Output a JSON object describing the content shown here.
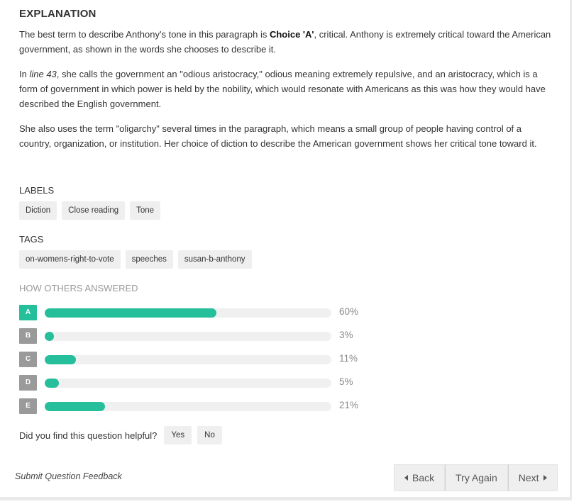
{
  "explanation": {
    "heading": "EXPLANATION",
    "p1_before": "The best term to describe Anthony's tone in this paragraph is ",
    "p1_bold": "Choice 'A'",
    "p1_after": ", critical. Anthony is extremely critical toward the American government, as shown in the words she chooses to describe it.",
    "p2_before": "In ",
    "p2_italic": "line 43",
    "p2_after": ", she calls the government an \"odious aristocracy,\" odious meaning extremely repulsive, and an aristocracy, which is a form of government in which power is held by the nobility, which would resonate with Americans as this was how they would have described the English government.",
    "p3": "She also uses the term \"oligarchy\" several times in the paragraph, which means a small group of people having control of a country, organization, or institution. Her choice of diction to describe the American government shows her critical tone toward it."
  },
  "labels": {
    "title": "LABELS",
    "items": [
      "Diction",
      "Close reading",
      "Tone"
    ]
  },
  "tags": {
    "title": "TAGS",
    "items": [
      "on-womens-right-to-vote",
      "speeches",
      "susan-b-anthony"
    ]
  },
  "others": {
    "title": "HOW OTHERS ANSWERED",
    "answers": [
      {
        "letter": "A",
        "pct_label": "60%",
        "value": 0.6,
        "correct": true
      },
      {
        "letter": "B",
        "pct_label": "3%",
        "value": 0.03,
        "correct": false
      },
      {
        "letter": "C",
        "pct_label": "11%",
        "value": 0.11,
        "correct": false
      },
      {
        "letter": "D",
        "pct_label": "5%",
        "value": 0.05,
        "correct": false
      },
      {
        "letter": "E",
        "pct_label": "21%",
        "value": 0.21,
        "correct": false
      }
    ]
  },
  "helpful": {
    "question": "Did you find this question helpful?",
    "yes": "Yes",
    "no": "No"
  },
  "footer": {
    "feedback": "Submit Question Feedback",
    "back": "Back",
    "try_again": "Try Again",
    "next": "Next"
  },
  "colors": {
    "accent": "#26bf9b",
    "letter_gray": "#9a9a9a",
    "track": "#f0f0f0"
  }
}
